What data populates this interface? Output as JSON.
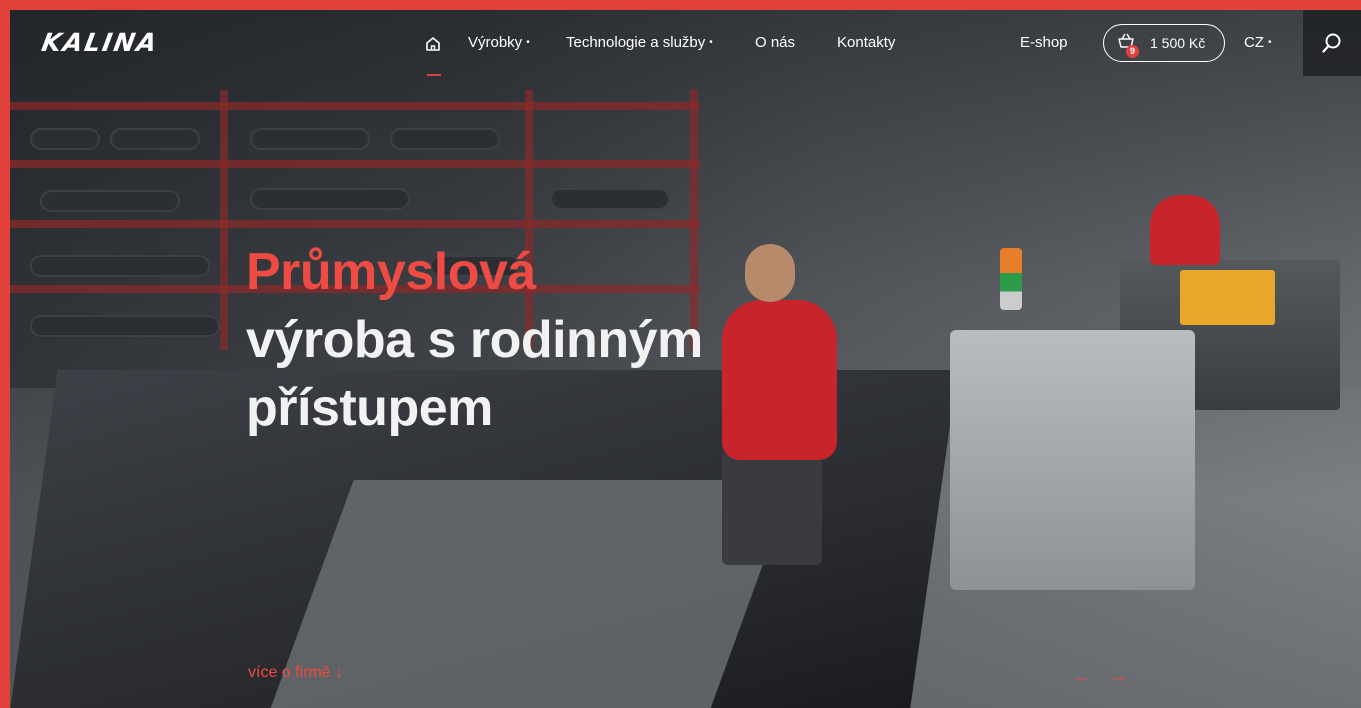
{
  "brand": {
    "logo_text": "KALINA",
    "accent_color": "#e0413b"
  },
  "nav": {
    "home_icon": "home-icon",
    "items": [
      {
        "label": "Výrobky",
        "has_dropdown": true
      },
      {
        "label": "Technologie a služby",
        "has_dropdown": true
      },
      {
        "label": "O nás",
        "has_dropdown": false
      },
      {
        "label": "Kontakty",
        "has_dropdown": false
      }
    ],
    "eshop": "E-shop",
    "cart": {
      "count": "9",
      "amount": "1 500 Kč",
      "icon": "basket-icon"
    },
    "language": {
      "label": "CZ",
      "has_dropdown": true
    },
    "search_icon": "search-icon"
  },
  "hero": {
    "line1": "Průmyslová",
    "line2": "výroba s rodinným",
    "line3": "přístupem",
    "more_link": "více o firmě ↓"
  },
  "slider": {
    "prev": "←",
    "next": "→"
  }
}
